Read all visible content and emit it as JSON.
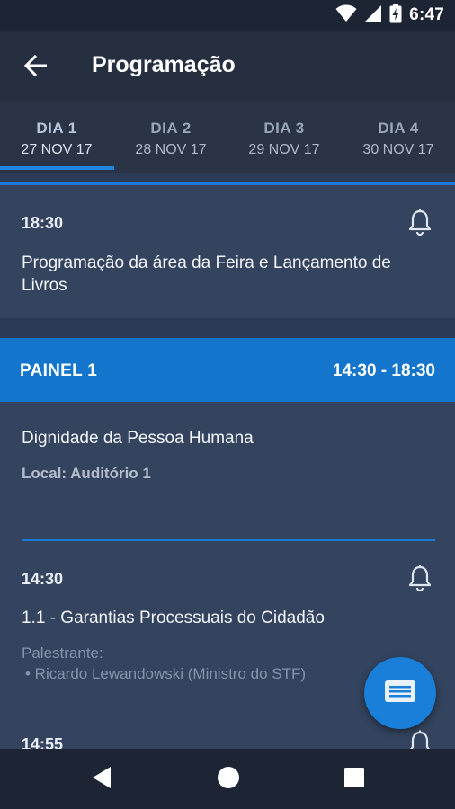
{
  "status_bar": {
    "time": "6:47",
    "icons": [
      "wifi-icon",
      "signal-icon",
      "battery-charging-icon"
    ]
  },
  "app_bar": {
    "title": "Programação",
    "back_icon": "arrow-left-icon"
  },
  "tabs": [
    {
      "label": "DIA 1",
      "date": "27 NOV 17",
      "active": true
    },
    {
      "label": "DIA 2",
      "date": "28 NOV 17",
      "active": false
    },
    {
      "label": "DIA 3",
      "date": "29 NOV 17",
      "active": false
    },
    {
      "label": "DIA 4",
      "date": "30 NOV 17",
      "active": false
    }
  ],
  "event1": {
    "time": "18:30",
    "title": "Programação da área da Feira e Lançamento de Livros"
  },
  "panel": {
    "name": "PAINEL 1",
    "time_range": "14:30 - 18:30",
    "topic": "Dignidade da Pessoa Humana",
    "local": "Local: Auditório 1"
  },
  "session1": {
    "time": "14:30",
    "title": "1.1 - Garantias Processuais do Cidadão",
    "speaker_label": "Palestrante:",
    "speaker": "• Ricardo Lewandowski (Ministro do STF)"
  },
  "session2": {
    "time": "14:55"
  },
  "colors": {
    "accent": "#1376cc",
    "background": "#2c3b55",
    "card": "#34445e"
  }
}
